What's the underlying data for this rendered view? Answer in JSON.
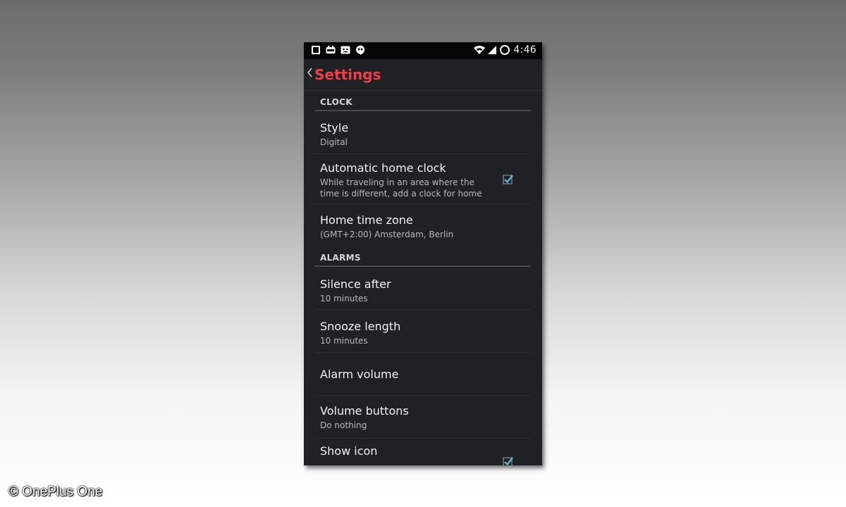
{
  "status_bar": {
    "time": "4:46",
    "left_icons": [
      "square-icon",
      "gamepad-icon",
      "messenger-icon",
      "hangouts-icon"
    ],
    "right_icons": [
      "wifi-icon",
      "signal-icon",
      "battery-ring-icon"
    ]
  },
  "action_bar": {
    "title": "Settings",
    "title_color": "#e8424c"
  },
  "sections": {
    "clock": {
      "header": "CLOCK"
    },
    "alarms": {
      "header": "ALARMS"
    }
  },
  "items": {
    "style": {
      "title": "Style",
      "summary": "Digital"
    },
    "auto_home_clock": {
      "title": "Automatic home clock",
      "summary": "While traveling in an area where the time is different, add a clock for home",
      "checked": true
    },
    "home_time_zone": {
      "title": "Home time zone",
      "summary": "(GMT+2:00) Amsterdam, Berlin"
    },
    "silence_after": {
      "title": "Silence after",
      "summary": "10 minutes"
    },
    "snooze_length": {
      "title": "Snooze length",
      "summary": "10 minutes"
    },
    "alarm_volume": {
      "title": "Alarm volume"
    },
    "volume_buttons": {
      "title": "Volume buttons",
      "summary": "Do nothing"
    },
    "show_icon": {
      "title": "Show icon",
      "checked": true
    }
  },
  "colors": {
    "accent_checkbox": "#5bb8e0",
    "background": "#202124"
  },
  "watermark": "© OnePlus One"
}
